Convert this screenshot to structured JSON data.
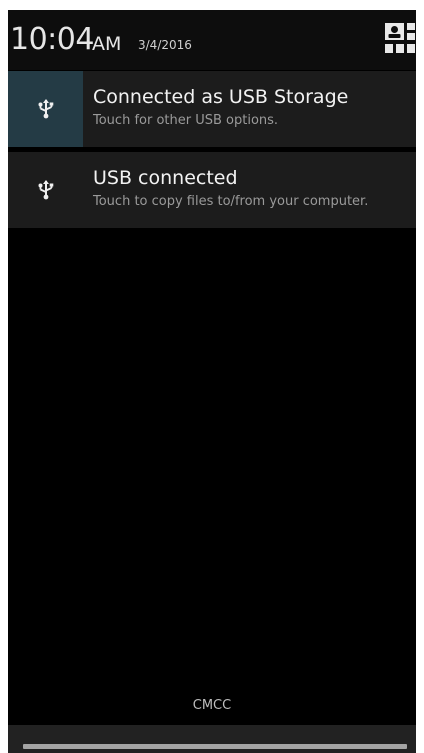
{
  "status": {
    "time": "10:04",
    "ampm": "AM",
    "date": "3/4/2016"
  },
  "quick_settings": {
    "icon": "quick-settings-user-icon"
  },
  "notifications": [
    {
      "icon": "usb-icon",
      "title": "Connected as USB Storage",
      "text": "Touch for other USB options."
    },
    {
      "icon": "usb-icon",
      "title": "USB connected",
      "text": "Touch to copy files to/from your computer."
    }
  ],
  "carrier": "CMCC",
  "colors": {
    "panel": "#000000",
    "notification": "#1c1c1c",
    "highlight_icon_bg": "#243b45"
  }
}
